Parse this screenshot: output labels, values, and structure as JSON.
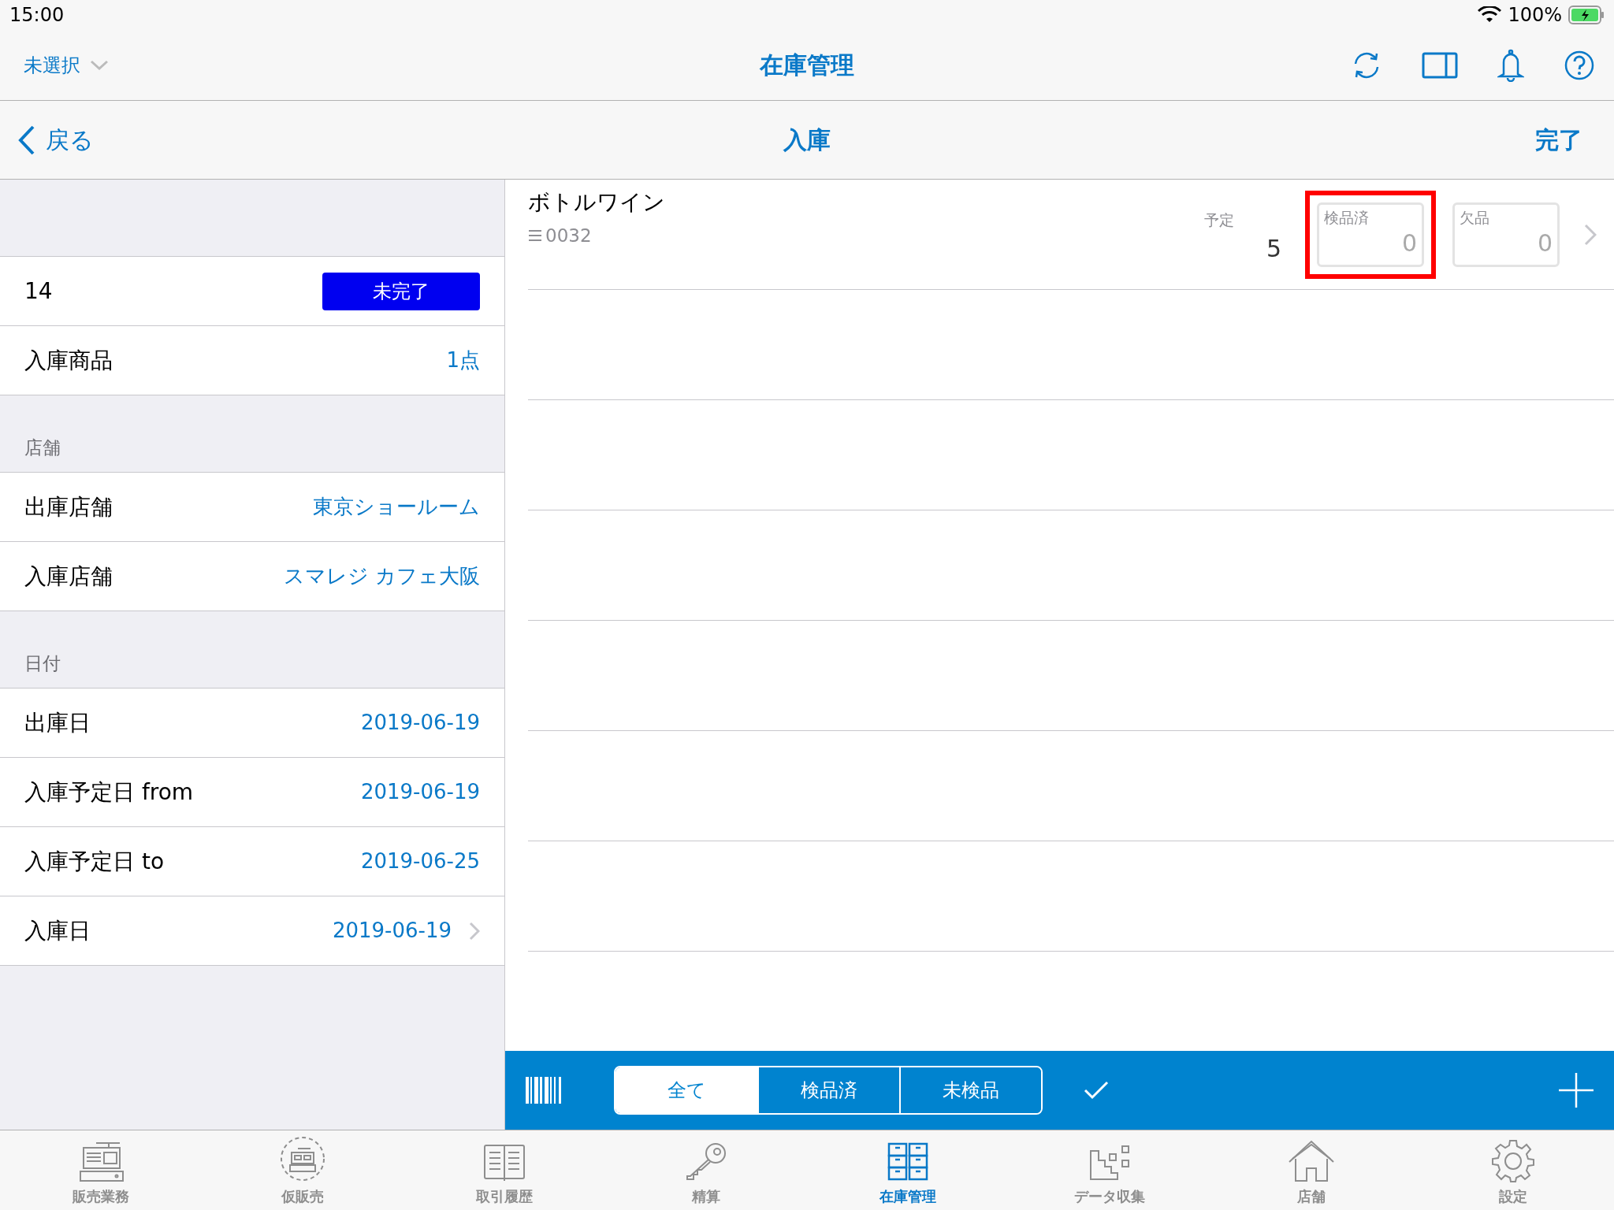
{
  "status_bar": {
    "time": "15:00",
    "battery": "100%"
  },
  "nav": {
    "store_selector": "未選択",
    "title": "在庫管理"
  },
  "subnav": {
    "back": "戻る",
    "title": "入庫",
    "done": "完了"
  },
  "sidebar": {
    "sections": [
      {
        "rows": [
          {
            "kind": "badge",
            "label": "14",
            "value": "未完了"
          },
          {
            "kind": "value",
            "label": "入庫商品",
            "value": "1点"
          }
        ]
      },
      {
        "header": "店舗",
        "rows": [
          {
            "kind": "value",
            "label": "出庫店舗",
            "value": "東京ショールーム"
          },
          {
            "kind": "value",
            "label": "入庫店舗",
            "value": "スマレジ カフェ大阪"
          }
        ]
      },
      {
        "header": "日付",
        "rows": [
          {
            "kind": "value",
            "label": "出庫日",
            "value": "2019-06-19"
          },
          {
            "kind": "value",
            "label": "入庫予定日 from",
            "value": "2019-06-19"
          },
          {
            "kind": "value",
            "label": "入庫予定日 to",
            "value": "2019-06-25"
          },
          {
            "kind": "disclosure",
            "label": "入庫日",
            "value": "2019-06-19"
          }
        ]
      }
    ]
  },
  "items": [
    {
      "name": "ボトルワイン",
      "code": "0032",
      "planned_label": "予定",
      "planned": "5",
      "fields": [
        {
          "label": "検品済",
          "value": "0",
          "highlighted": true
        },
        {
          "label": "欠品",
          "value": "0",
          "highlighted": false
        }
      ]
    }
  ],
  "filter": [
    {
      "label": "全て",
      "selected": true
    },
    {
      "label": "検品済",
      "selected": false
    },
    {
      "label": "未検品",
      "selected": false
    }
  ],
  "tabs": [
    {
      "label": "販売業務",
      "selected": false
    },
    {
      "label": "仮販売",
      "selected": false
    },
    {
      "label": "取引履歴",
      "selected": false
    },
    {
      "label": "精算",
      "selected": false
    },
    {
      "label": "在庫管理",
      "selected": true
    },
    {
      "label": "データ収集",
      "selected": false
    },
    {
      "label": "店舗",
      "selected": false
    },
    {
      "label": "設定",
      "selected": false
    }
  ]
}
